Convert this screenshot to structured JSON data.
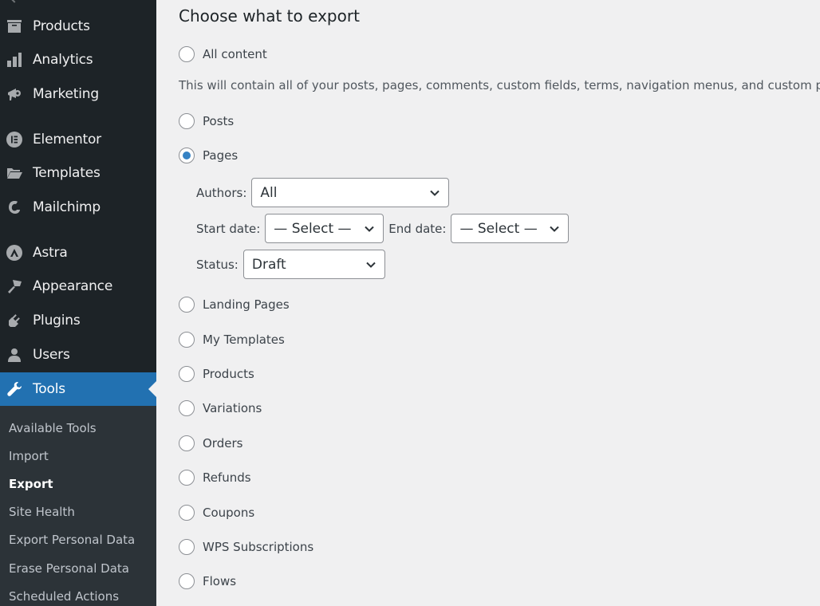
{
  "sidebar": {
    "items": [
      {
        "label": "Products",
        "icon": "archive-box-icon"
      },
      {
        "label": "Analytics",
        "icon": "bar-chart-icon"
      },
      {
        "label": "Marketing",
        "icon": "megaphone-icon"
      },
      {
        "label": "Elementor",
        "icon": "elementor-icon"
      },
      {
        "label": "Templates",
        "icon": "folder-icon"
      },
      {
        "label": "Mailchimp",
        "icon": "mailchimp-icon"
      },
      {
        "label": "Astra",
        "icon": "astra-icon"
      },
      {
        "label": "Appearance",
        "icon": "paintbrush-icon"
      },
      {
        "label": "Plugins",
        "icon": "plug-icon"
      },
      {
        "label": "Users",
        "icon": "user-icon"
      },
      {
        "label": "Tools",
        "icon": "wrench-icon",
        "active": true
      }
    ],
    "submenu": [
      {
        "label": "Available Tools"
      },
      {
        "label": "Import"
      },
      {
        "label": "Export",
        "current": true
      },
      {
        "label": "Site Health"
      },
      {
        "label": "Export Personal Data"
      },
      {
        "label": "Erase Personal Data"
      },
      {
        "label": "Scheduled Actions"
      }
    ]
  },
  "main": {
    "heading": "Choose what to export",
    "all_content": {
      "label": "All content",
      "checked": false
    },
    "all_content_description": "This will contain all of your posts, pages, comments, custom fields, terms, navigation menus, and custom posts.",
    "options_before": [
      {
        "label": "Posts",
        "checked": false
      },
      {
        "label": "Pages",
        "checked": true
      }
    ],
    "filters": {
      "authors": {
        "label": "Authors:",
        "value": "All"
      },
      "start_date": {
        "label": "Start date:",
        "value": "— Select —"
      },
      "end_date": {
        "label": "End date:",
        "value": "— Select —"
      },
      "status": {
        "label": "Status:",
        "value": "Draft"
      }
    },
    "options_after": [
      {
        "label": "Landing Pages",
        "checked": false
      },
      {
        "label": "My Templates",
        "checked": false
      },
      {
        "label": "Products",
        "checked": false
      },
      {
        "label": "Variations",
        "checked": false
      },
      {
        "label": "Orders",
        "checked": false
      },
      {
        "label": "Refunds",
        "checked": false
      },
      {
        "label": "Coupons",
        "checked": false
      },
      {
        "label": "WPS Subscriptions",
        "checked": false
      },
      {
        "label": "Flows",
        "checked": false
      }
    ]
  },
  "colors": {
    "sidebar_bg": "#1d2327",
    "submenu_bg": "#2c3338",
    "accent": "#2271b1",
    "radio_checked": "#3582c4",
    "page_bg": "#f0f0f1"
  }
}
